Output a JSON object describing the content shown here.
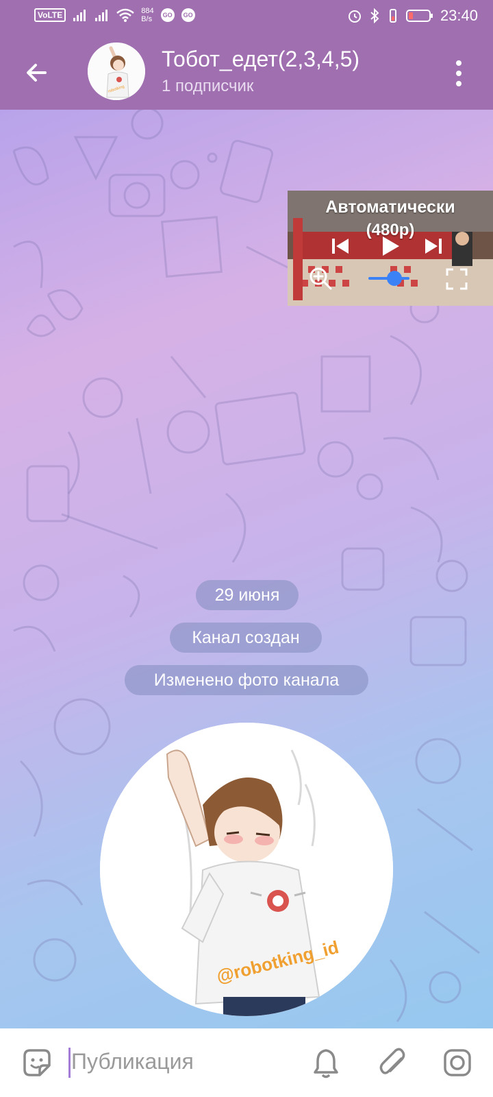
{
  "status_bar": {
    "volte": "VoLTE",
    "net_speed_value": "884",
    "net_speed_unit": "B/s",
    "go_badge": "GO",
    "time": "23:40"
  },
  "header": {
    "title": "Тобот_едет(2,3,4,5)",
    "subtitle": "1 подписчик"
  },
  "pip": {
    "title": "Автоматически",
    "subtitle": "(480p)"
  },
  "messages": {
    "date": "29 июня",
    "service_1": "Канал создан",
    "service_2": "Изменено фото канала",
    "photo_watermark": "@robotking_id"
  },
  "input": {
    "placeholder": "Публикация"
  },
  "colors": {
    "header": "#9f6fb0",
    "accent": "#a27cd6"
  }
}
